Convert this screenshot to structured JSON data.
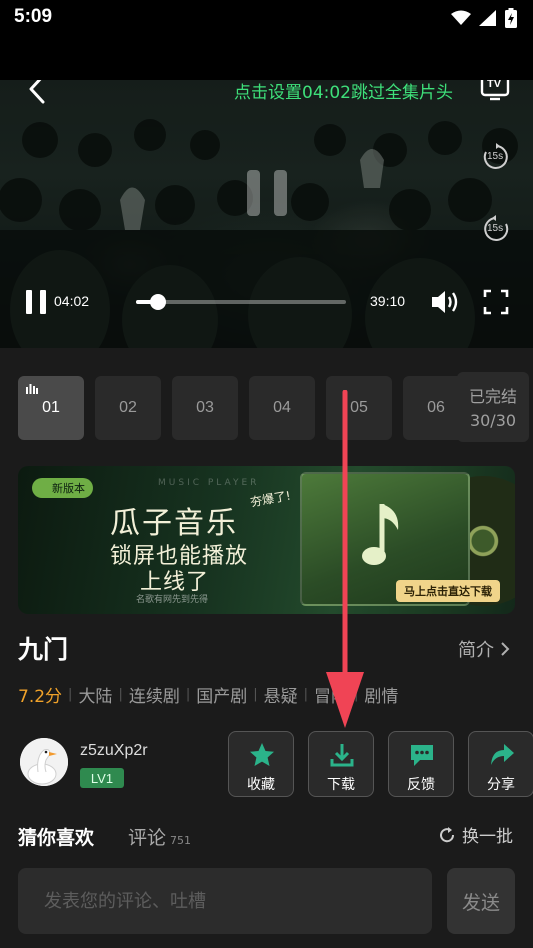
{
  "status_bar": {
    "time": "5:09"
  },
  "player": {
    "skip_tip": "点击设置04:02跳过全集片头",
    "tv_label": "TV",
    "forward_label": "15s",
    "rewind_label": "15s",
    "current_time": "04:02",
    "total_time": "39:10",
    "progress": 0.103
  },
  "episodes": {
    "items": [
      "01",
      "02",
      "03",
      "04",
      "05",
      "06"
    ],
    "active_index": 0,
    "complete_label": "已完结",
    "complete_count": "30/30"
  },
  "banner": {
    "badge": "新版本",
    "deco_text": "MUSIC PLAYER",
    "title": "瓜子音乐",
    "subtitle_1": "锁屏也能播放",
    "subtitle_2": "上线了",
    "hot_tag": "夯爆了!",
    "note": "名歌有网先到先得",
    "cta": "马上点击直达下载"
  },
  "show": {
    "title": "九门",
    "intro_label": "简介",
    "rating": "7.2分",
    "tags": [
      "大陆",
      "连续剧",
      "国产剧",
      "悬疑",
      "冒险",
      "剧情"
    ]
  },
  "user": {
    "name": "z5zuXp2r",
    "level": "LV1"
  },
  "actions": {
    "favorite": "收藏",
    "download": "下载",
    "feedback": "反馈",
    "share": "分享"
  },
  "tabs": {
    "guess": "猜你喜欢",
    "comments": "评论",
    "comment_count": "751",
    "refresh": "换一批"
  },
  "comment_box": {
    "placeholder": "发表您的评论、吐槽",
    "send": "发送"
  },
  "colors": {
    "accent_green": "#3ee07a",
    "rating_orange": "#f0a22a",
    "level_green": "#2f8a4f",
    "icon_teal": "#2bb38a",
    "arrow_red": "#f04455"
  }
}
